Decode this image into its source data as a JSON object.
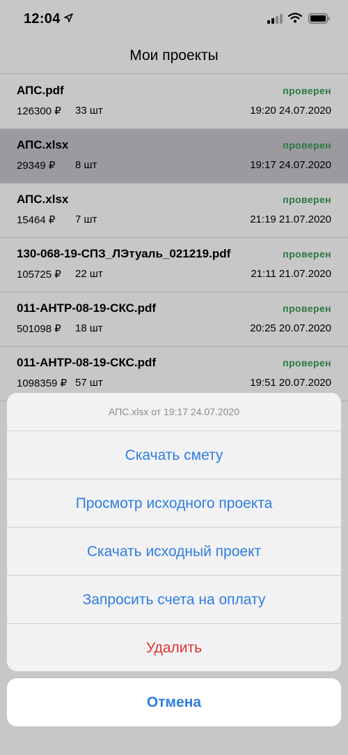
{
  "status_bar": {
    "time": "12:04"
  },
  "nav": {
    "title": "Мои проекты"
  },
  "projects": [
    {
      "name": "АПС.pdf",
      "status": "проверен",
      "price": "126300 ₽",
      "count": "33 шт",
      "date": "19:20 24.07.2020"
    },
    {
      "name": "АПС.xlsx",
      "status": "проверен",
      "price": "29349 ₽",
      "count": "8 шт",
      "date": "19:17 24.07.2020"
    },
    {
      "name": "АПС.xlsx",
      "status": "проверен",
      "price": "15464 ₽",
      "count": "7 шт",
      "date": "21:19 21.07.2020"
    },
    {
      "name": "130-068-19-СПЗ_ЛЭтуаль_021219.pdf",
      "status": "проверен",
      "price": "105725 ₽",
      "count": "22 шт",
      "date": "21:11 21.07.2020"
    },
    {
      "name": "011-АНТР-08-19-СКС.pdf",
      "status": "проверен",
      "price": "501098 ₽",
      "count": "18 шт",
      "date": "20:25 20.07.2020"
    },
    {
      "name": "011-АНТР-08-19-СКС.pdf",
      "status": "проверен",
      "price": "1098359 ₽",
      "count": "57 шт",
      "date": "19:51 20.07.2020"
    }
  ],
  "action_sheet": {
    "title": "АПС.xlsx от 19:17 24.07.2020",
    "download_estimate": "Скачать смету",
    "view_source": "Просмотр исходного проекта",
    "download_source": "Скачать исходный проект",
    "request_invoices": "Запросить счета на оплату",
    "delete": "Удалить",
    "cancel": "Отмена"
  },
  "colors": {
    "status_green": "#3a9a57",
    "action_blue": "#2f7de1",
    "destructive_red": "#e0342b",
    "selected_row": "#c7c7cc"
  },
  "icons": [
    "location-arrow-icon",
    "cellular-signal-icon",
    "wifi-icon",
    "battery-icon"
  ]
}
